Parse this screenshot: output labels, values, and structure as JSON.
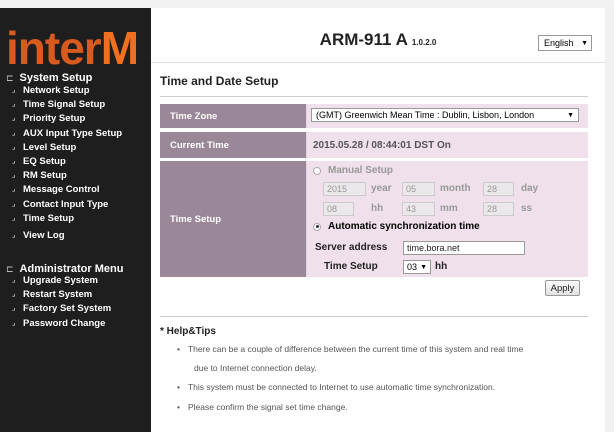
{
  "brand": {
    "logo_main": "interM",
    "logo_prefix": "inter",
    "logo_suffix": "M",
    "accent": "#d85a1e"
  },
  "header": {
    "model": "ARM-911 A",
    "version": "1.0.2.0",
    "language": "English"
  },
  "sidebar": {
    "system_setup": {
      "title": "System Setup",
      "items": [
        "Network Setup",
        "Time Signal Setup",
        "Priority Setup",
        "AUX Input Type Setup",
        "Level Setup",
        "EQ Setup",
        "RM Setup",
        "Message Control",
        "Contact Input Type",
        "Time Setup",
        "View Log"
      ]
    },
    "admin_menu": {
      "title": "Administrator Menu",
      "items": [
        "Upgrade System",
        "Restart System",
        "Factory Set System",
        "Password Change"
      ]
    }
  },
  "page": {
    "title": "Time and Date Setup",
    "timezone": {
      "label": "Time Zone",
      "value": "(GMT) Greenwich Mean Time : Dublin, Lisbon, London"
    },
    "current_time": {
      "label": "Current Time",
      "value": "2015.05.28 / 08:44:01 DST On"
    },
    "time_setup": {
      "label": "Time Setup",
      "manual": {
        "label": "Manual Setup",
        "selected": false,
        "year": "2015",
        "year_label": "year",
        "month": "05",
        "month_label": "month",
        "day": "28",
        "day_label": "day",
        "hour": "08",
        "hour_label": "hh",
        "minute": "43",
        "minute_label": "mm",
        "second": "28",
        "second_label": "ss"
      },
      "automatic": {
        "label": "Automatic synchronization time",
        "selected": true,
        "server_label": "Server address",
        "server_value": "time.bora.net",
        "time_setup_label": "Time Setup",
        "hour_value": "03",
        "hour_unit": "hh"
      }
    },
    "apply_label": "Apply"
  },
  "help": {
    "title": "* Help&Tips",
    "tips": [
      "There can be a couple of difference between the current time of this system and real time",
      "due to Internet connection delay.",
      "This system must be connected to Internet to use automatic time synchronization.",
      "Please confirm the signal set time change."
    ]
  }
}
